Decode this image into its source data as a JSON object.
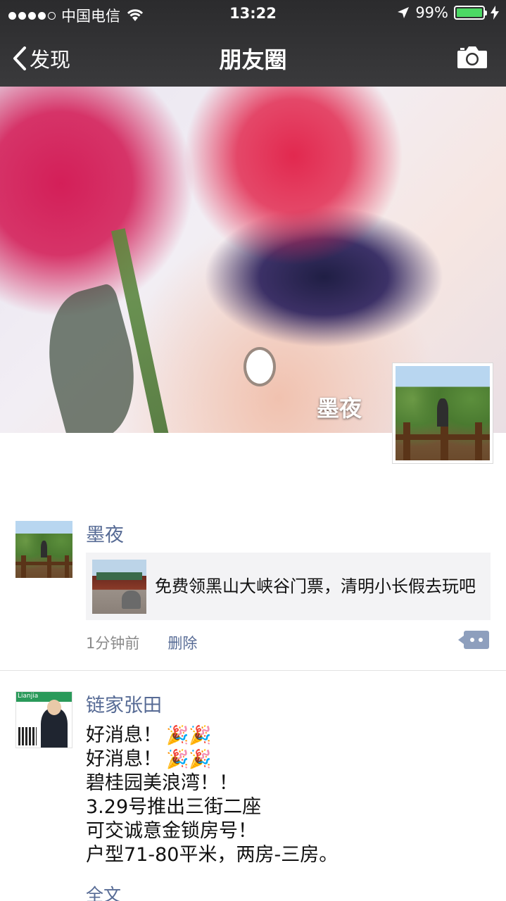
{
  "status_bar": {
    "carrier": "中国电信",
    "time": "13:22",
    "battery_percent": "99%",
    "battery_level": 0.99,
    "signal_bars_filled": 4,
    "icons": [
      "signal-dots-icon",
      "wifi-icon",
      "location-arrow-icon",
      "battery-icon",
      "charging-bolt-icon"
    ]
  },
  "nav": {
    "back_label": "发现",
    "title": "朋友圈",
    "right_icon": "camera-icon"
  },
  "cover": {
    "name": "墨夜"
  },
  "posts": [
    {
      "user": "墨夜",
      "link_text": "免费领黑山大峡谷门票，清明小长假去玩吧",
      "time": "1分钟前",
      "delete_label": "删除",
      "action_icon": "comment-icon"
    },
    {
      "user": "链家张田",
      "avatar_brand": "Lianjia",
      "lines": [
        "好消息！",
        "好消息！",
        "碧桂园美浪湾！！",
        "3.29号推出三街二座",
        "可交诚意金锁房号！",
        "户型71-80平米，两房-三房。"
      ],
      "emoji": "🎉🎉",
      "full_text_label": "全文"
    }
  ],
  "colors": {
    "link_blue": "#576b95",
    "battery_green": "#4cd964",
    "nav_bg": "#2b2b2d",
    "card_bg": "#f3f3f5"
  }
}
